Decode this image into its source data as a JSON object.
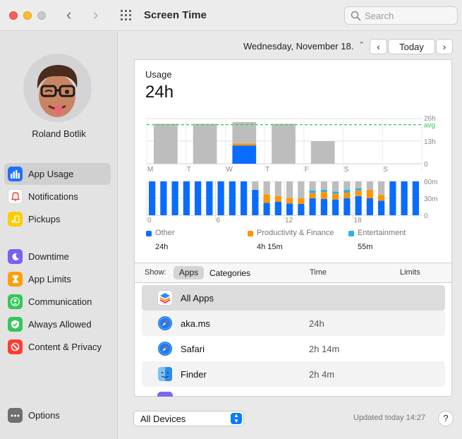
{
  "window": {
    "title": "Screen Time",
    "search_placeholder": "Search"
  },
  "user": {
    "name": "Roland Botlik"
  },
  "sidebar": {
    "items": [
      {
        "label": "App Usage",
        "icon": "bar-chart-icon",
        "color": "#1f6fff",
        "active": true
      },
      {
        "label": "Notifications",
        "icon": "bell-icon",
        "color": "#ff3b30"
      },
      {
        "label": "Pickups",
        "icon": "pickup-icon",
        "color": "#ffcc00"
      },
      {
        "label": "Downtime",
        "icon": "moon-icon",
        "color": "#7d5ff0"
      },
      {
        "label": "App Limits",
        "icon": "hourglass-icon",
        "color": "#ff9f0a"
      },
      {
        "label": "Communication",
        "icon": "person-icon",
        "color": "#34c759"
      },
      {
        "label": "Always Allowed",
        "icon": "checkmark-icon",
        "color": "#34c759"
      },
      {
        "label": "Content & Privacy",
        "icon": "block-icon",
        "color": "#ff3b30"
      }
    ],
    "options_label": "Options"
  },
  "date_bar": {
    "date": "Wednesday, November 18.",
    "today_label": "Today"
  },
  "usage": {
    "title": "Usage",
    "total": "24h"
  },
  "chart_data": [
    {
      "type": "bar",
      "categories": [
        "M",
        "T",
        "W",
        "T",
        "F",
        "S",
        "S"
      ],
      "series": [
        {
          "name": "Other",
          "values": [
            null,
            null,
            10.5,
            null,
            null,
            null,
            null
          ]
        },
        {
          "name": "Productivity & Finance",
          "values": [
            null,
            null,
            1.2,
            null,
            null,
            null,
            null
          ]
        },
        {
          "name": "Entertainment",
          "values": [
            null,
            null,
            0.0,
            null,
            null,
            null,
            null
          ]
        }
      ],
      "totals": [
        23,
        23,
        24,
        23,
        13,
        0,
        0
      ],
      "ylim": [
        0,
        26
      ],
      "y_ticks": [
        "26h",
        "13h",
        "0"
      ],
      "avg_label": "avg",
      "avg_value": 22.5
    },
    {
      "type": "bar",
      "x_ticks": [
        "0",
        "6",
        "12",
        "18"
      ],
      "y_ticks": [
        "60m",
        "30m",
        "0"
      ],
      "ylim": [
        0,
        60
      ],
      "hourly": [
        [
          60,
          0,
          0,
          0
        ],
        [
          60,
          0,
          0,
          0
        ],
        [
          60,
          0,
          0,
          0
        ],
        [
          60,
          0,
          0,
          0
        ],
        [
          60,
          0,
          0,
          0
        ],
        [
          60,
          0,
          0,
          0
        ],
        [
          60,
          0,
          0,
          0
        ],
        [
          60,
          0,
          0,
          0
        ],
        [
          60,
          0,
          0,
          0
        ],
        [
          45,
          0,
          0,
          15
        ],
        [
          22,
          15,
          0,
          23
        ],
        [
          24,
          10,
          0,
          26
        ],
        [
          21,
          10,
          0,
          29
        ],
        [
          20,
          10,
          0,
          30
        ],
        [
          30,
          9,
          5,
          16
        ],
        [
          29,
          12,
          4,
          15
        ],
        [
          28,
          10,
          4,
          18
        ],
        [
          30,
          10,
          5,
          15
        ],
        [
          34,
          10,
          4,
          12
        ],
        [
          30,
          15,
          0,
          15
        ],
        [
          26,
          10,
          0,
          24
        ],
        [
          60,
          0,
          0,
          0
        ],
        [
          60,
          0,
          0,
          0
        ],
        [
          60,
          0,
          0,
          0
        ]
      ],
      "hourly_note_order": [
        "other",
        "productivity",
        "entertainment",
        "remaining"
      ]
    }
  ],
  "legend": [
    {
      "name": "Other",
      "value": "24h",
      "color": "#0a6cff"
    },
    {
      "name": "Productivity & Finance",
      "value": "4h 15m",
      "color": "#ff9500"
    },
    {
      "name": "Entertainment",
      "value": "55m",
      "color": "#30b0e0"
    }
  ],
  "table": {
    "show_label": "Show:",
    "apps_label": "Apps",
    "categories_label": "Categories",
    "time_header": "Time",
    "limits_header": "Limits",
    "rows": [
      {
        "name": "All Apps",
        "time": "",
        "icon": "stack-icon"
      },
      {
        "name": "aka.ms",
        "time": "24h",
        "icon": "compass-icon"
      },
      {
        "name": "Safari",
        "time": "2h 14m",
        "icon": "compass-icon"
      },
      {
        "name": "Finder",
        "time": "2h 4m",
        "icon": "finder-icon"
      }
    ]
  },
  "footer": {
    "devices_label": "All Devices",
    "updated": "Updated today 14:27",
    "help": "?"
  },
  "colors": {
    "other": "#0a6cff",
    "productivity": "#ff9500",
    "entertainment": "#30b0e0",
    "empty": "#bdbdbd",
    "avg_line": "#34c759"
  }
}
